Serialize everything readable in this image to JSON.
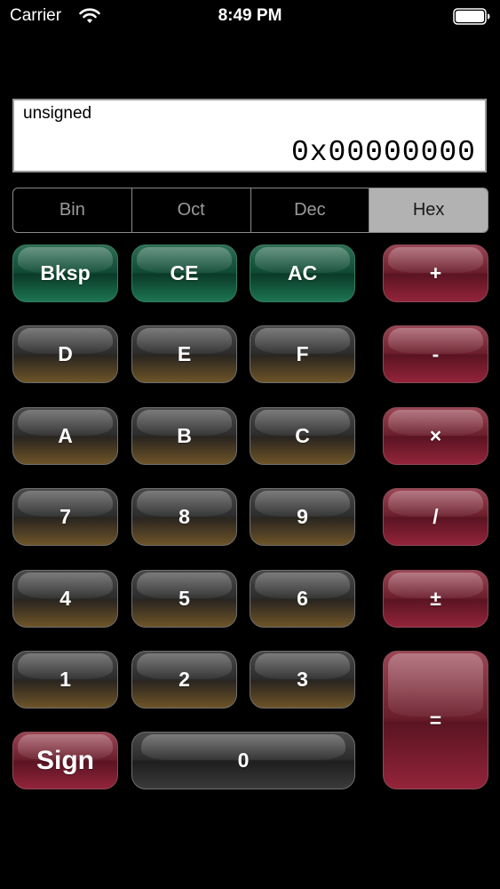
{
  "status_bar": {
    "carrier": "Carrier",
    "time": "8:49 PM"
  },
  "display": {
    "mode": "unsigned",
    "value": "0x00000000"
  },
  "bases": {
    "items": [
      "Bin",
      "Oct",
      "Dec",
      "Hex"
    ],
    "selected": "Hex"
  },
  "keys": {
    "bksp": "Bksp",
    "ce": "CE",
    "ac": "AC",
    "plus": "+",
    "d": "D",
    "e": "E",
    "f": "F",
    "minus": "-",
    "a": "A",
    "b": "B",
    "c": "C",
    "multiply": "×",
    "seven": "7",
    "eight": "8",
    "nine": "9",
    "divide": "/",
    "four": "4",
    "five": "5",
    "six": "6",
    "plus_minus": "±",
    "one": "1",
    "two": "2",
    "three": "3",
    "equals": "=",
    "sign": "Sign",
    "zero": "0"
  },
  "colors": {
    "background": "#000000",
    "clear_keys": "#0f4a35",
    "digit_keys": "#2c2c2c",
    "operator_keys": "#6b1e2c"
  }
}
